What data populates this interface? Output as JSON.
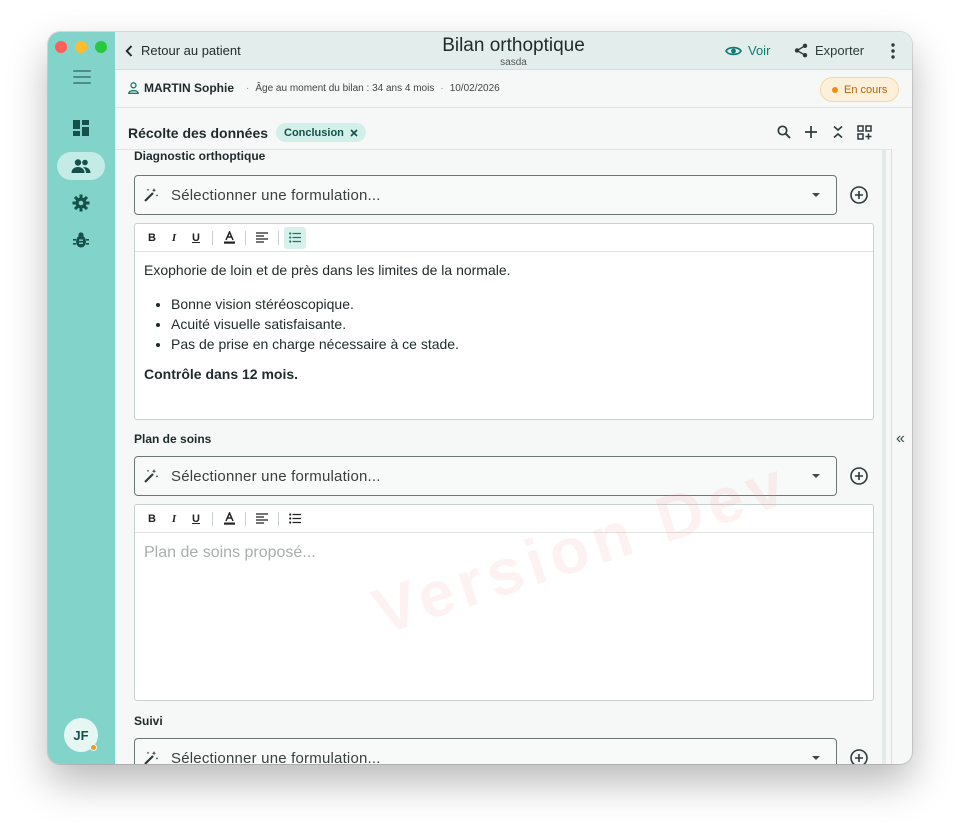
{
  "topbar": {
    "back_label": "Retour au patient",
    "title": "Bilan orthoptique",
    "subtitle": "sasda",
    "view_label": "Voir",
    "export_label": "Exporter"
  },
  "patient": {
    "name": "MARTIN Sophie",
    "age": "Âge au moment du bilan : 34 ans 4 mois",
    "date": "10/02/2026",
    "status": "En cours",
    "status_color": "#ef8c0f"
  },
  "user": {
    "initials": "JF"
  },
  "section": {
    "title": "Récolte des données",
    "chip": "Conclusion"
  },
  "watermark": "Version Dev",
  "fields": {
    "diagnostic": {
      "label": "Diagnostic orthoptique",
      "select_placeholder": "Sélectionner une formulation...",
      "intro": "Exophorie de loin et de près dans les limites de la normale.",
      "bullets": [
        "Bonne vision stéréoscopique.",
        "Acuité visuelle satisfaisante.",
        "Pas de prise en charge nécessaire à ce stade."
      ],
      "conclusion": "Contrôle dans 12 mois."
    },
    "plan": {
      "label": "Plan de soins",
      "select_placeholder": "Sélectionner une formulation...",
      "editor_placeholder": "Plan de soins proposé..."
    },
    "suivi": {
      "label": "Suivi",
      "select_placeholder": "Sélectionner une formulation..."
    }
  },
  "toolbar": {
    "bold": "B",
    "italic": "I",
    "underline": "U"
  },
  "colors": {
    "sidebar": "#82d3c9",
    "accent": "#0f7b70"
  }
}
